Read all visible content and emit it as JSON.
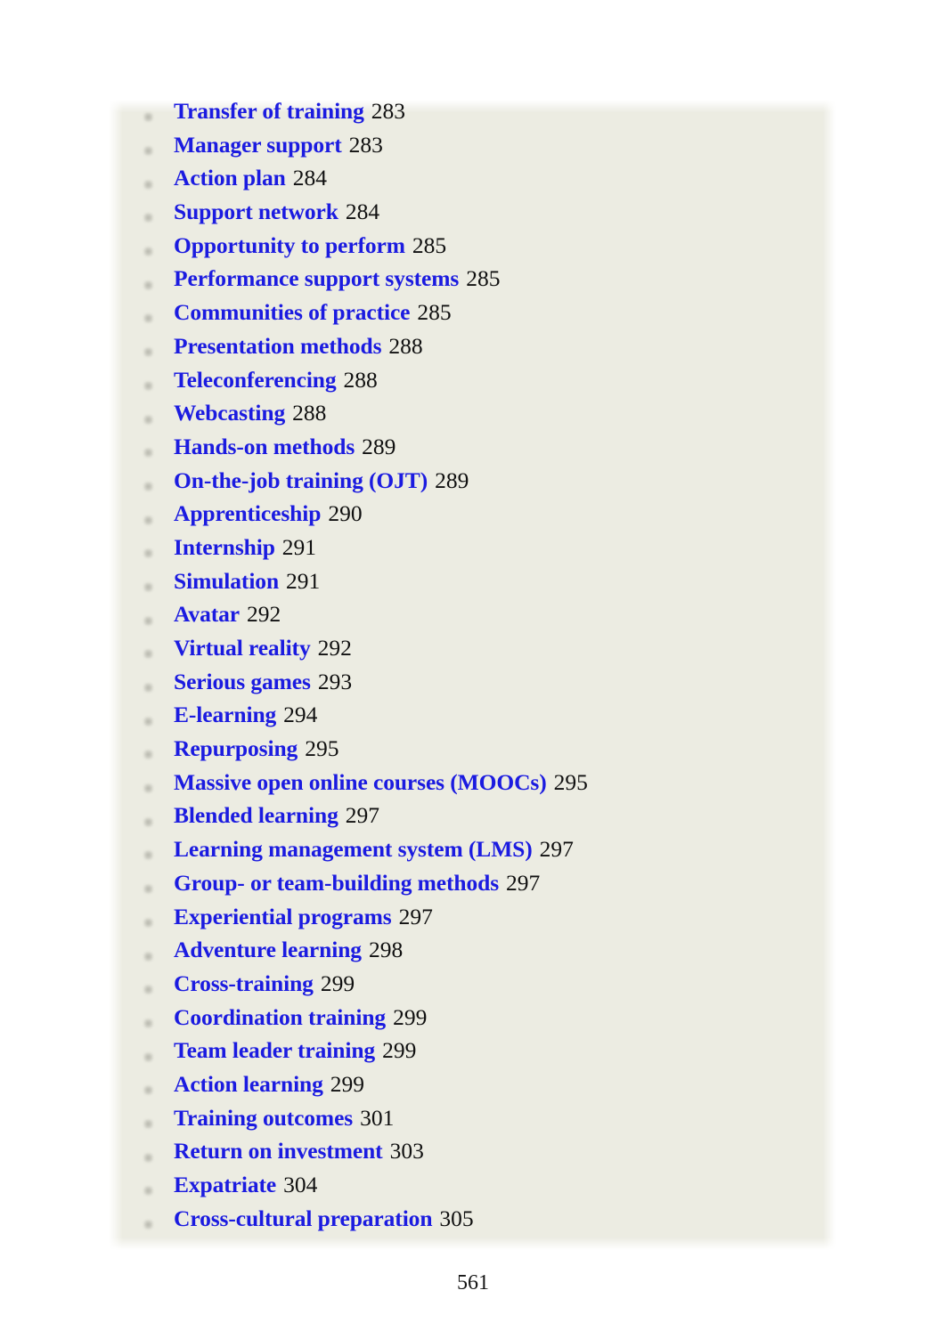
{
  "document": {
    "page_number": "561",
    "background_color": "#ecece2",
    "entry_title_color": "#1b1be0",
    "entry_page_color": "#101010",
    "bullet_icon": "square-bullet-icon"
  },
  "toc": {
    "entries": [
      {
        "title": "Transfer of training",
        "page": "283"
      },
      {
        "title": "Manager support",
        "page": "283"
      },
      {
        "title": "Action plan",
        "page": "284"
      },
      {
        "title": "Support network",
        "page": "284"
      },
      {
        "title": "Opportunity to perform",
        "page": "285"
      },
      {
        "title": "Performance support systems",
        "page": "285"
      },
      {
        "title": "Communities of practice",
        "page": "285"
      },
      {
        "title": "Presentation methods",
        "page": "288"
      },
      {
        "title": "Teleconferencing",
        "page": "288"
      },
      {
        "title": "Webcasting",
        "page": "288"
      },
      {
        "title": "Hands-on methods",
        "page": "289"
      },
      {
        "title": "On-the-job training (OJT)",
        "page": "289"
      },
      {
        "title": "Apprenticeship",
        "page": "290"
      },
      {
        "title": "Internship",
        "page": "291"
      },
      {
        "title": "Simulation",
        "page": "291"
      },
      {
        "title": "Avatar",
        "page": "292"
      },
      {
        "title": "Virtual reality",
        "page": "292"
      },
      {
        "title": "Serious games",
        "page": "293"
      },
      {
        "title": "E-learning",
        "page": "294"
      },
      {
        "title": "Repurposing",
        "page": "295"
      },
      {
        "title": "Massive open online courses (MOOCs)",
        "page": "295"
      },
      {
        "title": "Blended learning",
        "page": "297"
      },
      {
        "title": "Learning management system (LMS)",
        "page": "297"
      },
      {
        "title": "Group- or team-building methods",
        "page": "297"
      },
      {
        "title": "Experiential programs",
        "page": "297"
      },
      {
        "title": "Adventure learning",
        "page": "298"
      },
      {
        "title": "Cross-training",
        "page": "299"
      },
      {
        "title": "Coordination training",
        "page": "299"
      },
      {
        "title": "Team leader training",
        "page": "299"
      },
      {
        "title": "Action learning",
        "page": "299"
      },
      {
        "title": "Training outcomes",
        "page": "301"
      },
      {
        "title": "Return on investment",
        "page": "303"
      },
      {
        "title": "Expatriate",
        "page": "304"
      },
      {
        "title": "Cross-cultural preparation",
        "page": "305"
      }
    ]
  }
}
